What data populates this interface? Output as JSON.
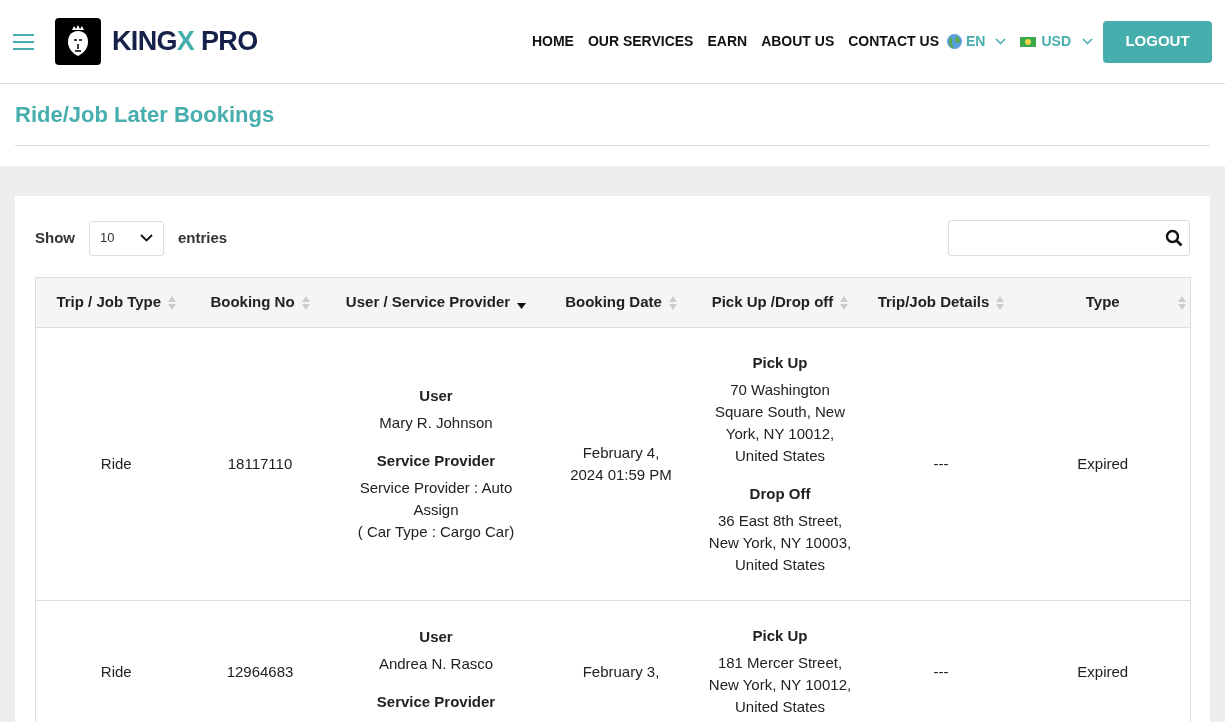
{
  "header": {
    "brand": {
      "part_1": "KING",
      "part_2": "X",
      "part_3": " PRO"
    },
    "nav": [
      "HOME",
      "OUR SERVICES",
      "EARN",
      "ABOUT US",
      "CONTACT US"
    ],
    "language": "EN",
    "currency": "USD",
    "logout": "LOGOUT"
  },
  "page_title": "Ride/Job Later Bookings",
  "controls": {
    "show_label": "Show",
    "page_size": "10",
    "entries_label": "entries"
  },
  "table": {
    "columns": [
      {
        "label": "Trip / Job Type",
        "sorted": false
      },
      {
        "label": "Booking No",
        "sorted": false
      },
      {
        "label": "User / Service Provider",
        "sorted": true
      },
      {
        "label": "Booking Date",
        "sorted": false
      },
      {
        "label": "Pick Up /Drop off",
        "sorted": false
      },
      {
        "label": "Trip/Job Details",
        "sorted": false
      },
      {
        "label": "Type",
        "sorted": false
      }
    ],
    "rows": [
      {
        "type": "Ride",
        "booking_no": "18117110",
        "user_heading": "User",
        "user": "Mary R. Johnson",
        "provider_heading": "Service Provider",
        "provider": "Service Provider : Auto Assign",
        "car_type": "( Car Type : Cargo Car)",
        "date": "February 4, 2024 01:59 PM",
        "pickup_heading": "Pick Up",
        "pickup": "70 Washington Square South, New York, NY 10012, United States",
        "dropoff_heading": "Drop Off",
        "dropoff": "36 East 8th Street, New York, NY 10003, United States",
        "details": "---",
        "status": "Expired"
      },
      {
        "type": "Ride",
        "booking_no": "12964683",
        "user_heading": "User",
        "user": "Andrea N. Rasco",
        "provider_heading": "Service Provider",
        "date": "February 3,",
        "pickup_heading": "Pick Up",
        "pickup": "181 Mercer Street, New York, NY 10012, United States",
        "details": "---",
        "status": "Expired"
      }
    ]
  }
}
